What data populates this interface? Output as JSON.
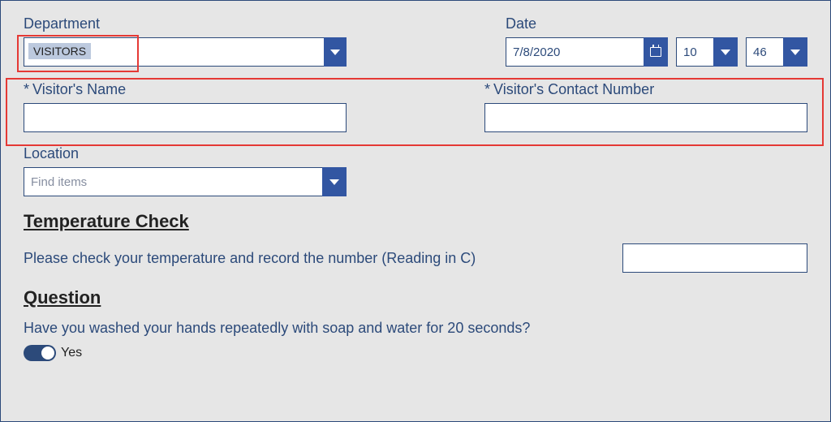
{
  "department": {
    "label": "Department",
    "selected": "VISITORS"
  },
  "date": {
    "label": "Date",
    "value": "7/8/2020",
    "hour": "10",
    "minute": "46"
  },
  "visitor_name": {
    "required_mark": "*",
    "label": "Visitor's Name",
    "value": ""
  },
  "visitor_contact": {
    "required_mark": "*",
    "label": "Visitor's Contact Number",
    "value": ""
  },
  "location": {
    "label": "Location",
    "placeholder": "Find items"
  },
  "temperature": {
    "heading": "Temperature Check",
    "prompt": "Please check your temperature and record the number (Reading in C)",
    "value": ""
  },
  "question": {
    "heading": "Question",
    "prompt": "Have you washed your hands repeatedly with soap and water for 20 seconds?",
    "toggle_label": "Yes"
  }
}
